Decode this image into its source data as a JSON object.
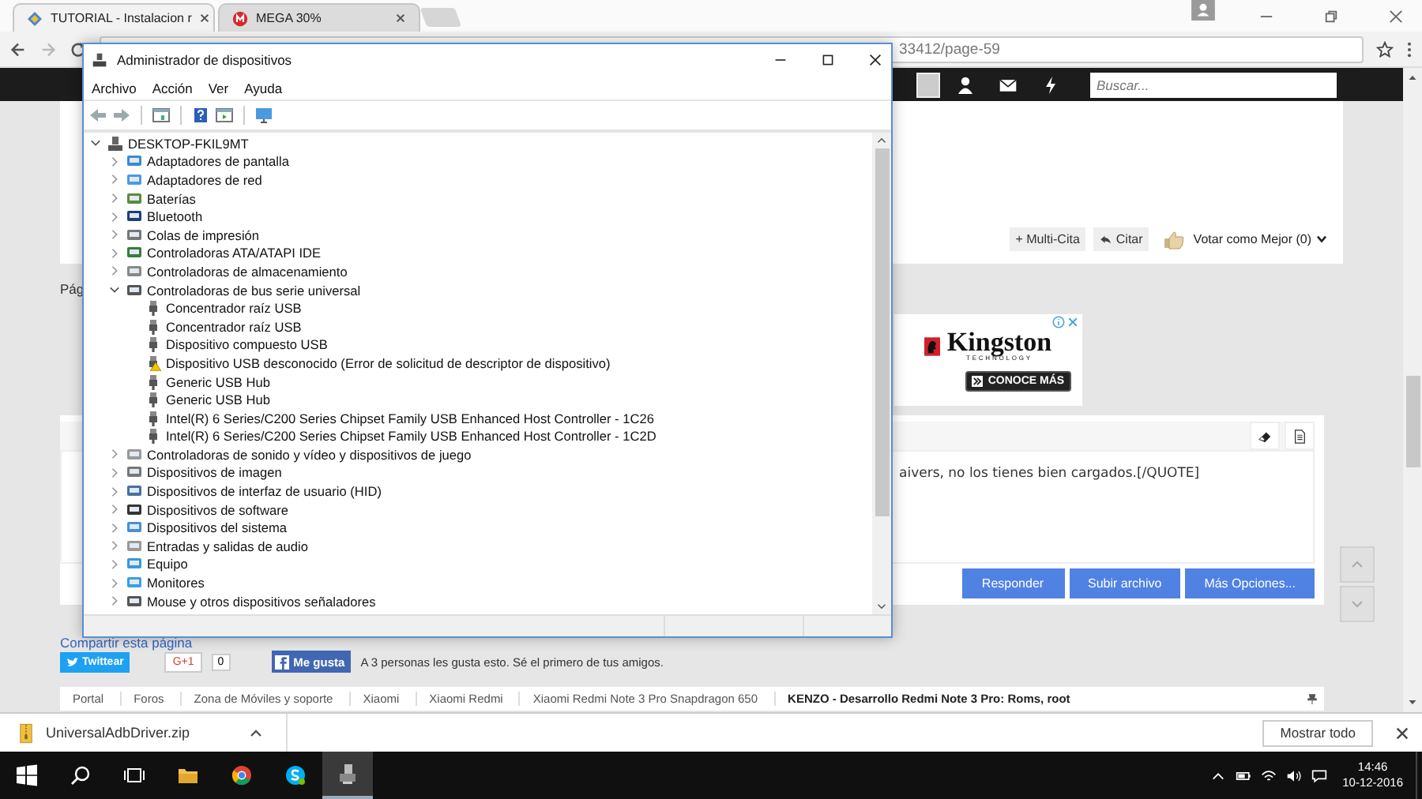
{
  "browser": {
    "tabs": [
      {
        "title": "TUTORIAL - Instalacion r",
        "selected": true
      },
      {
        "title": "MEGA 30%",
        "selected": false
      }
    ],
    "address": "33412/page-59"
  },
  "site_nav": {
    "search": {
      "placeholder": "Buscar..."
    }
  },
  "post_actions": [
    "+ Multi-Cita",
    "Citar",
    "Votar como Mejor (0)"
  ],
  "page_label": "Pág",
  "ad": {
    "brand": "Kingston",
    "tagline": "TECHNOLOGY",
    "button": "CONOCE MÁS"
  },
  "editor": {
    "text": "aivers, no los tienes bien cargados.[/QUOTE]",
    "buttons": [
      "Responder",
      "Subir archivo",
      "Más Opciones..."
    ]
  },
  "share": {
    "heading": "Compartir esta página",
    "twitter": "Twittear",
    "gplus": "G+1",
    "gplus_count": "0",
    "facebook": "Me gusta",
    "facebook_note": "A 3 personas les gusta esto. Sé el primero de tus amigos."
  },
  "breadcrumbs": [
    "Portal",
    "Foros",
    "Zona de Móviles y soporte",
    "Xiaomi",
    "Xiaomi Redmi",
    "Xiaomi Redmi Note 3 Pro Snapdragon 650",
    "KENZO - Desarrollo Redmi Note 3 Pro: Roms, root"
  ],
  "download_bar": {
    "file": "UniversalAdbDriver.zip",
    "show_all": "Mostrar todo"
  },
  "device_manager": {
    "title": "Administrador de dispositivos",
    "menu": [
      "Archivo",
      "Acción",
      "Ver",
      "Ayuda"
    ],
    "tree": {
      "label": "DESKTOP-FKIL9MT",
      "kind": "computer",
      "expanded": true,
      "children": [
        {
          "label": "Adaptadores de pantalla",
          "kind": "category",
          "expanded": false
        },
        {
          "label": "Adaptadores de red",
          "kind": "category",
          "expanded": false
        },
        {
          "label": "Baterías",
          "kind": "category",
          "expanded": false
        },
        {
          "label": "Bluetooth",
          "kind": "category",
          "expanded": false
        },
        {
          "label": "Colas de impresión",
          "kind": "category",
          "expanded": false
        },
        {
          "label": "Controladoras ATA/ATAPI IDE",
          "kind": "category",
          "expanded": false
        },
        {
          "label": "Controladoras de almacenamiento",
          "kind": "category",
          "expanded": false
        },
        {
          "label": "Controladoras de bus serie universal",
          "kind": "category",
          "expanded": true,
          "children": [
            {
              "label": "Concentrador raíz USB",
              "kind": "device",
              "warning": false
            },
            {
              "label": "Concentrador raíz USB",
              "kind": "device",
              "warning": false
            },
            {
              "label": "Dispositivo compuesto USB",
              "kind": "device",
              "warning": false
            },
            {
              "label": "Dispositivo USB desconocido (Error de solicitud de descriptor de dispositivo)",
              "kind": "device",
              "warning": true
            },
            {
              "label": "Generic USB Hub",
              "kind": "device",
              "warning": false
            },
            {
              "label": "Generic USB Hub",
              "kind": "device",
              "warning": false
            },
            {
              "label": "Intel(R) 6 Series/C200 Series Chipset Family USB Enhanced Host Controller - 1C26",
              "kind": "device",
              "warning": false
            },
            {
              "label": "Intel(R) 6 Series/C200 Series Chipset Family USB Enhanced Host Controller - 1C2D",
              "kind": "device",
              "warning": false
            }
          ]
        },
        {
          "label": "Controladoras de sonido y vídeo y dispositivos de juego",
          "kind": "category",
          "expanded": false
        },
        {
          "label": "Dispositivos de imagen",
          "kind": "category",
          "expanded": false
        },
        {
          "label": "Dispositivos de interfaz de usuario (HID)",
          "kind": "category",
          "expanded": false
        },
        {
          "label": "Dispositivos de software",
          "kind": "category",
          "expanded": false
        },
        {
          "label": "Dispositivos del sistema",
          "kind": "category",
          "expanded": false
        },
        {
          "label": "Entradas y salidas de audio",
          "kind": "category",
          "expanded": false
        },
        {
          "label": "Equipo",
          "kind": "category",
          "expanded": false
        },
        {
          "label": "Monitores",
          "kind": "category",
          "expanded": false
        },
        {
          "label": "Mouse y otros dispositivos señaladores",
          "kind": "category",
          "expanded": false
        }
      ]
    }
  },
  "taskbar": {
    "time": "14:46",
    "date": "10-12-2016"
  }
}
